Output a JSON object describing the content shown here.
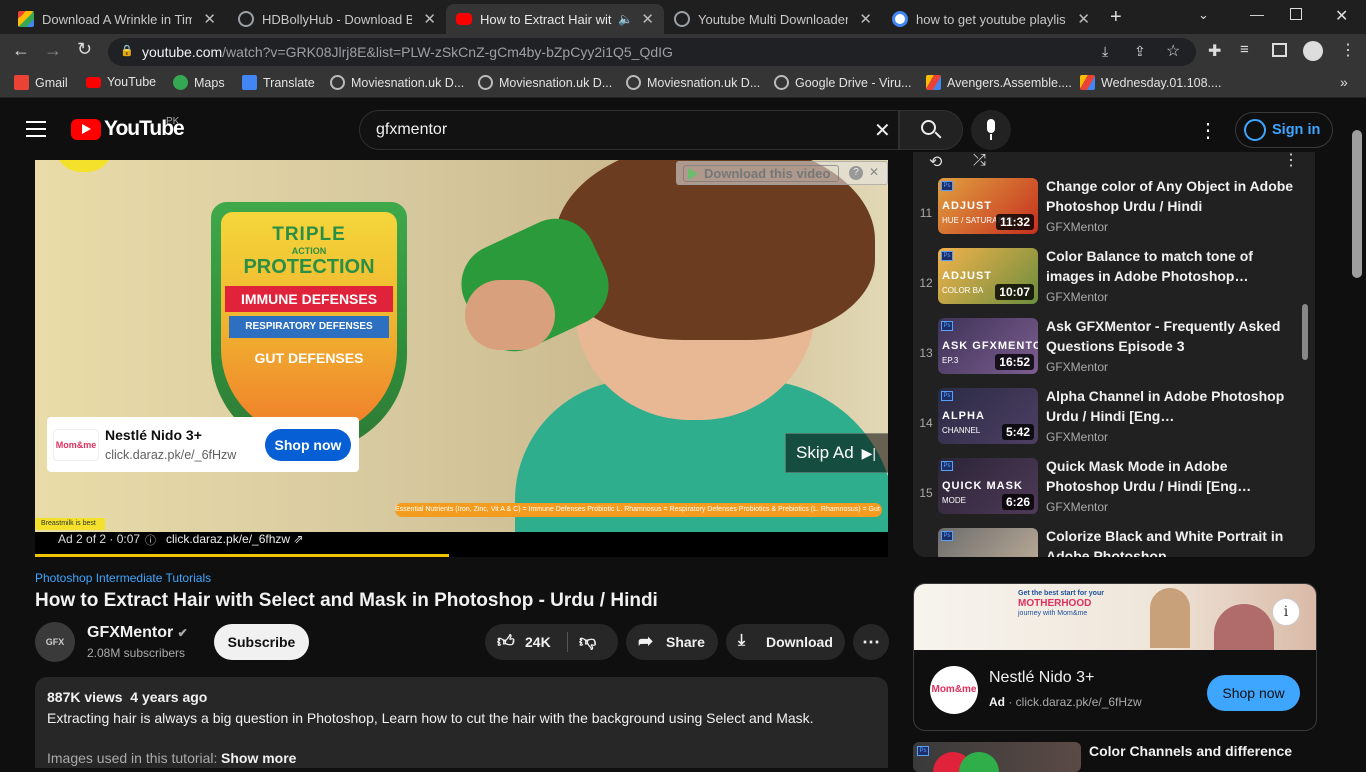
{
  "browser": {
    "tabs": [
      {
        "title": "Download A Wrinkle in Time",
        "icon": "gmail-icon",
        "color": "#4a7bd6"
      },
      {
        "title": "HDBollyHub - Download Boll",
        "icon": "globe-icon",
        "color": "#9aa0a6"
      },
      {
        "title": "How to Extract Hair with",
        "icon": "youtube-icon",
        "color": "#ff0000"
      },
      {
        "title": "Youtube Multi Downloader C",
        "icon": "globe-icon",
        "color": "#9aa0a6"
      },
      {
        "title": "how to get youtube playlist l",
        "icon": "google-icon",
        "color": "#4285f4"
      }
    ],
    "url_domain": "youtube.com",
    "url_path": "/watch?v=GRK08Jlrj8E&list=PLW-zSkCnZ-gCm4by-bZpCyy2i1Q5_QdIG",
    "bookmarks": [
      "Gmail",
      "YouTube",
      "Maps",
      "Translate",
      "Moviesnation.uk D...",
      "Moviesnation.uk D...",
      "Moviesnation.uk D...",
      "Google Drive - Viru...",
      "Avengers.Assemble....",
      "Wednesday.01.108...."
    ]
  },
  "header": {
    "logo_text": "YouTube",
    "country": "PK",
    "search_value": "gfxmentor",
    "signin_label": "Sign in"
  },
  "player": {
    "shield_line1": "TRIPLE",
    "shield_line2": "ACTION",
    "shield_line3": "PROTECTION",
    "shield_band1": "IMMUNE DEFENSES",
    "shield_band2": "RESPIRATORY DEFENSES",
    "shield_band3": "GUT DEFENSES",
    "download_overlay": "Download this video",
    "ad_brand": "Nestlé Nido 3+",
    "ad_url": "click.daraz.pk/e/_6fHzw",
    "ad_cta": "Shop now",
    "skip_label": "Skip Ad",
    "footer_strip": "Essential Nutrients (Iron, Zinc, Vit A & C) = Immune Defenses Probiotic L. Rhamnosus = Respiratory Defenses Probiotics & Prebiotics (L. Rhamnosus) = Gut Defenses",
    "breastmilk": "Breastmilk is best",
    "ad_counter": "Ad 2 of 2 · 0:07",
    "ad_link": "click.daraz.pk/e/_6fhzw",
    "progress_fraction": 0.485
  },
  "video": {
    "playlist_link": "Photoshop Intermediate Tutorials",
    "title": "How to Extract Hair with Select and Mask in Photoshop - Urdu / Hindi",
    "channel": "GFXMentor",
    "subscribers": "2.08M subscribers",
    "subscribe_label": "Subscribe",
    "likes": "24K",
    "share_label": "Share",
    "download_label": "Download",
    "views": "887K views",
    "age": "4 years ago",
    "description": "Extracting hair is always a big question in Photoshop, Learn how to cut the hair with the background using Select and Mask.",
    "desc_line2": "Images used in this tutorial:",
    "show_more": "Show more"
  },
  "playlist": {
    "items": [
      {
        "num": "11",
        "title": "Change color of Any Object in Adobe Photoshop Urdu / Hindi",
        "channel": "GFXMentor",
        "duration": "11:32",
        "thumb_text": "ADJUST",
        "thumb_sub": "HUE / SATURATION",
        "c1": "#e0a040",
        "c2": "#c62f1f"
      },
      {
        "num": "12",
        "title": "Color Balance to match tone of images in Adobe Photoshop…",
        "channel": "GFXMentor",
        "duration": "10:07",
        "thumb_text": "ADJUST",
        "thumb_sub": "COLOR BA",
        "c1": "#f2b24b",
        "c2": "#6b8d3e"
      },
      {
        "num": "13",
        "title": "Ask GFXMentor - Frequently Asked Questions Episode 3",
        "channel": "GFXMentor",
        "duration": "16:52",
        "thumb_text": "ASK GFXMENTOR",
        "thumb_sub": "EP.3",
        "c1": "#3e3358",
        "c2": "#7c5d8f"
      },
      {
        "num": "14",
        "title": "Alpha Channel in Adobe Photoshop Urdu / Hindi [Eng…",
        "channel": "GFXMentor",
        "duration": "5:42",
        "thumb_text": "ALPHA",
        "thumb_sub": "CHANNEL",
        "c1": "#2b2b45",
        "c2": "#4d3f63"
      },
      {
        "num": "15",
        "title": "Quick Mask Mode in Adobe Photoshop Urdu / Hindi [Eng…",
        "channel": "GFXMentor",
        "duration": "6:26",
        "thumb_text": "QUICK MASK",
        "thumb_sub": "MODE",
        "c1": "#2a2436",
        "c2": "#4f3a58"
      },
      {
        "num": "16",
        "title": "Colorize Black and White Portrait in Adobe Photoshop…",
        "channel": "GFXMentor",
        "duration": "",
        "thumb_text": "",
        "thumb_sub": "",
        "c1": "#6d6d6d",
        "c2": "#c4b29c"
      }
    ]
  },
  "side_ad": {
    "banner_line1": "Get the best start for your",
    "banner_line2": "MOTHERHOOD",
    "banner_line3": "journey with Mom&me",
    "brand": "Nestlé Nido 3+",
    "ad_tag": "Ad",
    "url": "click.daraz.pk/e/_6fHzw",
    "cta": "Shop now"
  },
  "next_video": {
    "title": "Color Channels and difference"
  }
}
